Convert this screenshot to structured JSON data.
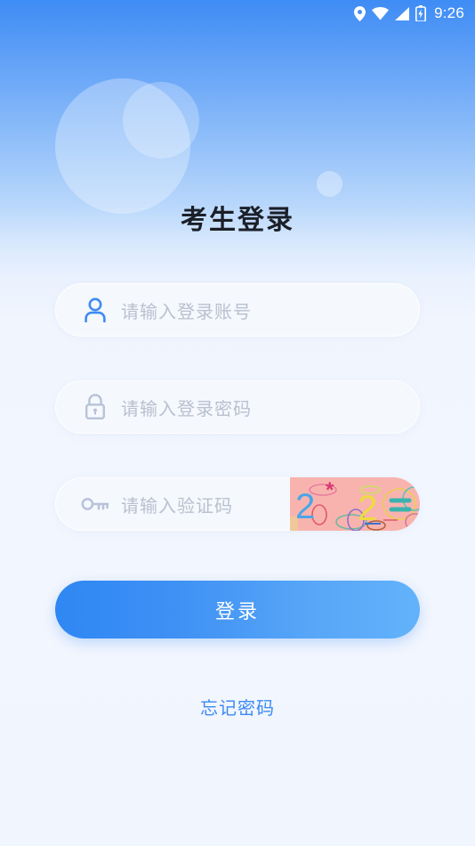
{
  "status_bar": {
    "time": "9:26",
    "icons": [
      "location-pin-icon",
      "wifi-icon",
      "signal-icon",
      "battery-charging-icon"
    ]
  },
  "page": {
    "title": "考生登录"
  },
  "form": {
    "fields": [
      {
        "name": "account",
        "icon": "person-icon",
        "placeholder": "请输入登录账号",
        "value": ""
      },
      {
        "name": "password",
        "icon": "lock-icon",
        "placeholder": "请输入登录密码",
        "value": ""
      },
      {
        "name": "captcha",
        "icon": "key-icon",
        "placeholder": "请输入验证码",
        "value": ""
      }
    ],
    "captcha_image": {
      "characters": "2 2 =",
      "background_color": "#f9b3ae"
    }
  },
  "actions": {
    "login_label": "登录",
    "forgot_password_label": "忘记密码"
  },
  "colors": {
    "accent": "#3d8bf2",
    "header_gradient_top": "#3e8cf5",
    "page_background": "#f2f6ff",
    "button_gradient_start": "#2f87f3",
    "button_gradient_end": "#62b2fb",
    "placeholder_text": "#b9c1cf",
    "title_text": "#1b1f28"
  }
}
